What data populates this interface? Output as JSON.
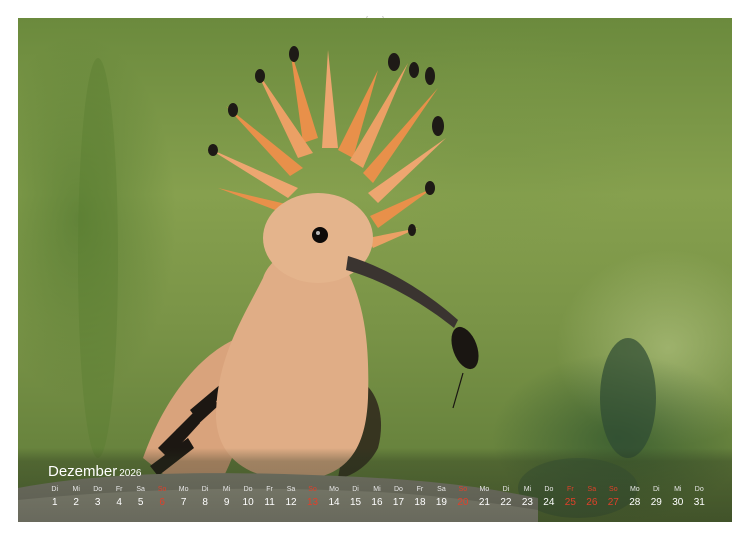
{
  "calendar": {
    "month": "Dezember",
    "year": "2026",
    "days": [
      {
        "name": "Di",
        "num": "1",
        "red": false
      },
      {
        "name": "Mi",
        "num": "2",
        "red": false
      },
      {
        "name": "Do",
        "num": "3",
        "red": false
      },
      {
        "name": "Fr",
        "num": "4",
        "red": false
      },
      {
        "name": "Sa",
        "num": "5",
        "red": false
      },
      {
        "name": "So",
        "num": "6",
        "red": true
      },
      {
        "name": "Mo",
        "num": "7",
        "red": false
      },
      {
        "name": "Di",
        "num": "8",
        "red": false
      },
      {
        "name": "Mi",
        "num": "9",
        "red": false
      },
      {
        "name": "Do",
        "num": "10",
        "red": false
      },
      {
        "name": "Fr",
        "num": "11",
        "red": false
      },
      {
        "name": "Sa",
        "num": "12",
        "red": false
      },
      {
        "name": "So",
        "num": "13",
        "red": true
      },
      {
        "name": "Mo",
        "num": "14",
        "red": false
      },
      {
        "name": "Di",
        "num": "15",
        "red": false
      },
      {
        "name": "Mi",
        "num": "16",
        "red": false
      },
      {
        "name": "Do",
        "num": "17",
        "red": false
      },
      {
        "name": "Fr",
        "num": "18",
        "red": false
      },
      {
        "name": "Sa",
        "num": "19",
        "red": false
      },
      {
        "name": "So",
        "num": "20",
        "red": true
      },
      {
        "name": "Mo",
        "num": "21",
        "red": false
      },
      {
        "name": "Di",
        "num": "22",
        "red": false
      },
      {
        "name": "Mi",
        "num": "23",
        "red": false
      },
      {
        "name": "Do",
        "num": "24",
        "red": false
      },
      {
        "name": "Fr",
        "num": "25",
        "red": true
      },
      {
        "name": "Sa",
        "num": "26",
        "red": true
      },
      {
        "name": "So",
        "num": "27",
        "red": true
      },
      {
        "name": "Mo",
        "num": "28",
        "red": false
      },
      {
        "name": "Di",
        "num": "29",
        "red": false
      },
      {
        "name": "Mi",
        "num": "30",
        "red": false
      },
      {
        "name": "Do",
        "num": "31",
        "red": false
      }
    ]
  },
  "colors": {
    "holiday": "#e0402a",
    "crest": "#e8904a",
    "plumage": "#e0ad86",
    "background": "#7a9447"
  },
  "photo": {
    "subject_icon": "hoopoe-bird-photo"
  }
}
